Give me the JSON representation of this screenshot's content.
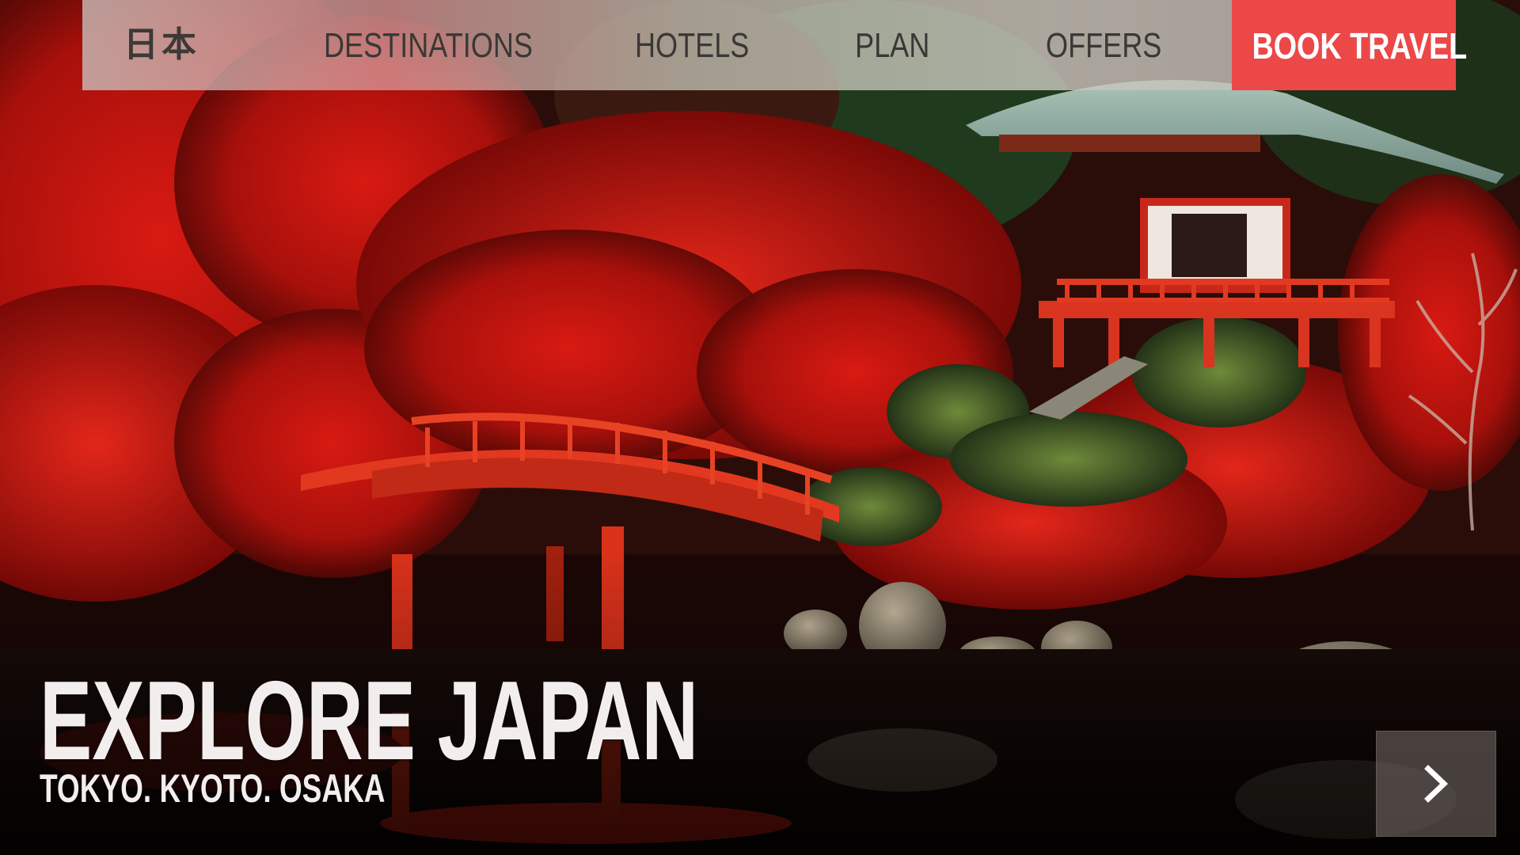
{
  "brand": {
    "logo_text": "日本"
  },
  "nav": {
    "links": [
      {
        "label": "DESTINATIONS"
      },
      {
        "label": "HOTELS"
      },
      {
        "label": "PLAN"
      },
      {
        "label": "OFFERS"
      }
    ],
    "cta_label": "BOOK TRAVEL"
  },
  "hero": {
    "title": "EXPLORE JAPAN",
    "subtitle": "TOKYO. KYOTO. OSAKA"
  },
  "slider": {
    "next_icon": "chevron-right-icon"
  },
  "colors": {
    "accent": "#ec4848",
    "text_light": "#f3eeee",
    "nav_text": "#3a3836"
  }
}
